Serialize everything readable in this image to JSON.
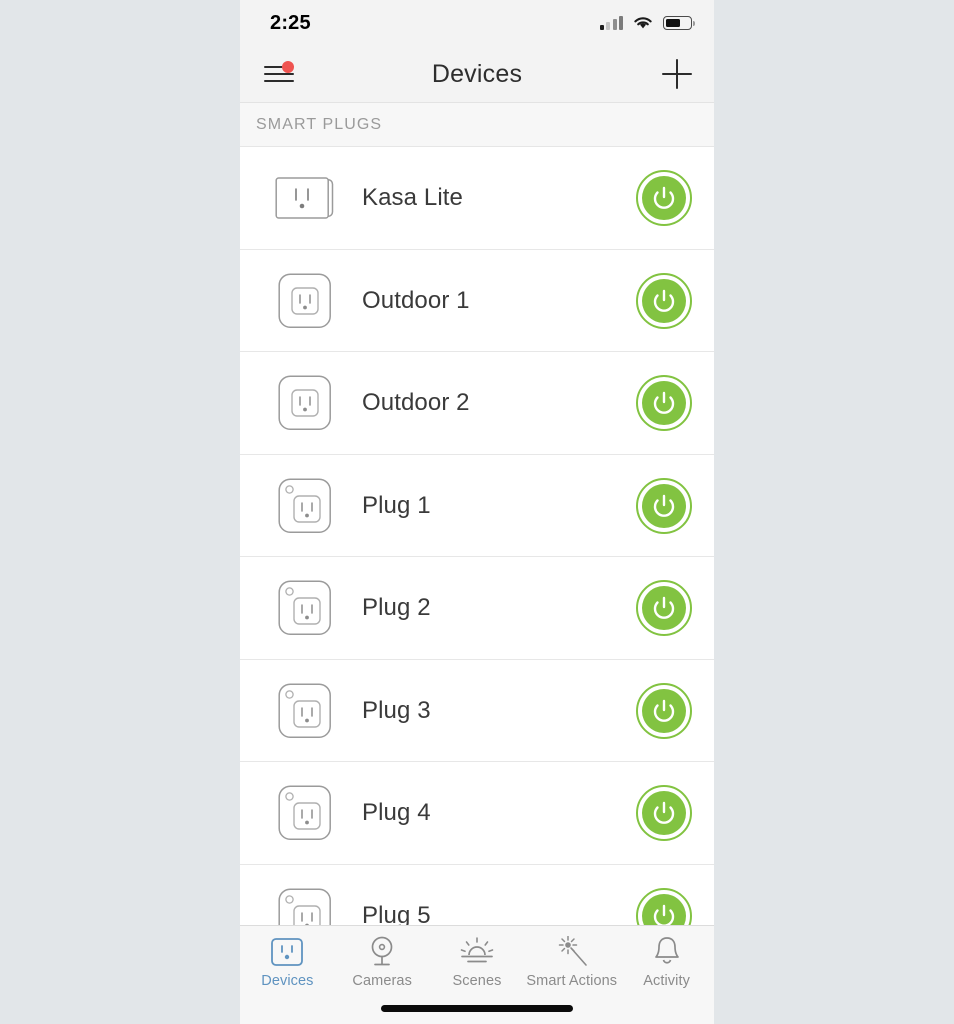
{
  "status_bar": {
    "time": "2:25",
    "signal_icon": "cellular-signal-icon",
    "wifi_icon": "wifi-icon",
    "battery_icon": "battery-icon",
    "battery_level_percent": 62
  },
  "nav_bar": {
    "menu_icon": "hamburger-menu-icon",
    "has_notification_badge": true,
    "badge_color": "#ef5350",
    "title": "Devices",
    "add_icon": "plus-icon"
  },
  "section": {
    "header": "SMART PLUGS"
  },
  "colors": {
    "toggle_on": "#82c341",
    "active_tab": "#5f93c0",
    "text_primary": "#3a3a3a",
    "text_muted": "#9a9a9a",
    "page_background": "#e2e6e9"
  },
  "devices": [
    {
      "name": "Kasa Lite",
      "icon": "smart-plug-lite-icon",
      "power_state": "on",
      "toggle_label": "power-toggle"
    },
    {
      "name": "Outdoor 1",
      "icon": "outdoor-plug-icon",
      "power_state": "on",
      "toggle_label": "power-toggle"
    },
    {
      "name": "Outdoor 2",
      "icon": "outdoor-plug-icon",
      "power_state": "on",
      "toggle_label": "power-toggle"
    },
    {
      "name": "Plug 1",
      "icon": "smart-plug-icon",
      "power_state": "on",
      "toggle_label": "power-toggle"
    },
    {
      "name": "Plug 2",
      "icon": "smart-plug-icon",
      "power_state": "on",
      "toggle_label": "power-toggle"
    },
    {
      "name": "Plug 3",
      "icon": "smart-plug-icon",
      "power_state": "on",
      "toggle_label": "power-toggle"
    },
    {
      "name": "Plug 4",
      "icon": "smart-plug-icon",
      "power_state": "on",
      "toggle_label": "power-toggle"
    },
    {
      "name": "Plug 5",
      "icon": "smart-plug-icon",
      "power_state": "on",
      "toggle_label": "power-toggle"
    }
  ],
  "tab_bar": {
    "active_index": 0,
    "tabs": [
      {
        "label": "Devices",
        "icon": "outlet-icon"
      },
      {
        "label": "Cameras",
        "icon": "camera-icon"
      },
      {
        "label": "Scenes",
        "icon": "sunrise-icon"
      },
      {
        "label": "Smart Actions",
        "icon": "magic-wand-icon"
      },
      {
        "label": "Activity",
        "icon": "bell-icon"
      }
    ]
  }
}
